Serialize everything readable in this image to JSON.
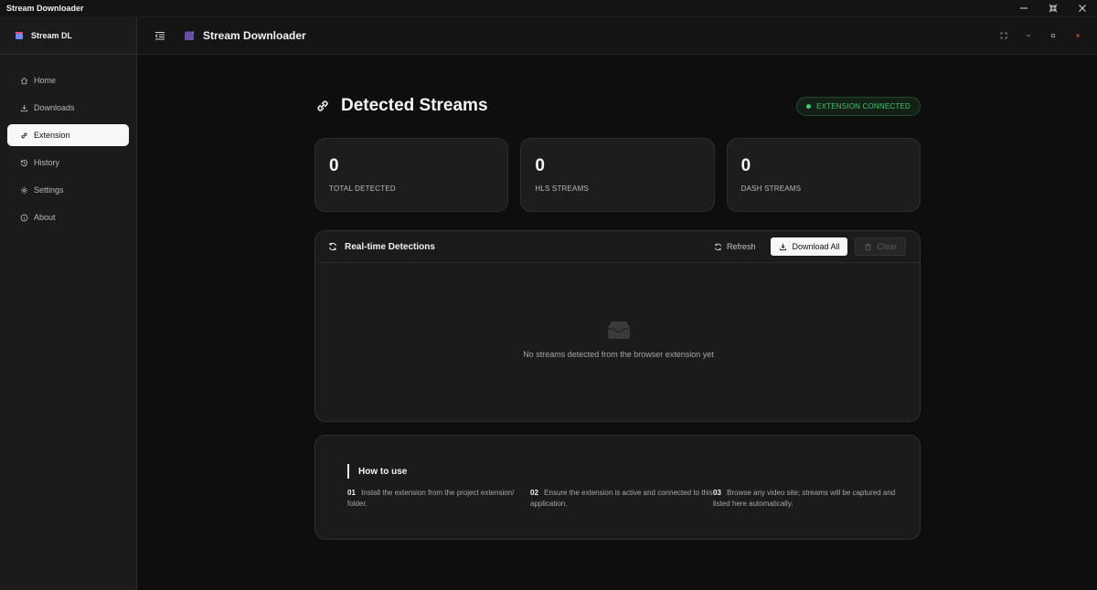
{
  "os_window": {
    "title": "Stream Downloader"
  },
  "sidebar": {
    "brand": "Stream DL",
    "items": [
      {
        "label": "Home",
        "icon": "home-icon",
        "active": false
      },
      {
        "label": "Downloads",
        "icon": "download-icon",
        "active": false
      },
      {
        "label": "Extension",
        "icon": "link-icon",
        "active": true
      },
      {
        "label": "History",
        "icon": "history-icon",
        "active": false
      },
      {
        "label": "Settings",
        "icon": "gear-icon",
        "active": false
      },
      {
        "label": "About",
        "icon": "info-icon",
        "active": false
      }
    ]
  },
  "header": {
    "title": "Stream Downloader"
  },
  "page": {
    "title": "Detected Streams",
    "status_badge": "EXTENSION CONNECTED"
  },
  "stats": [
    {
      "value": "0",
      "label": "TOTAL DETECTED"
    },
    {
      "value": "0",
      "label": "HLS STREAMS"
    },
    {
      "value": "0",
      "label": "DASH STREAMS"
    }
  ],
  "detections": {
    "title": "Real-time Detections",
    "refresh_label": "Refresh",
    "download_all_label": "Download All",
    "clear_label": "Clear",
    "empty_text": "No streams detected from the browser extension yet"
  },
  "howto": {
    "title": "How to use",
    "steps": [
      {
        "num": "01",
        "text": "Install the extension from the project extension/ folder."
      },
      {
        "num": "02",
        "text": "Ensure the extension is active and connected to this application."
      },
      {
        "num": "03",
        "text": "Browse any video site; streams will be captured and listed here automatically."
      }
    ]
  },
  "colors": {
    "accent_green": "#42c46a",
    "background": "#0e0e0e",
    "card": "#1d1d1d",
    "close_red": "#e05050"
  }
}
